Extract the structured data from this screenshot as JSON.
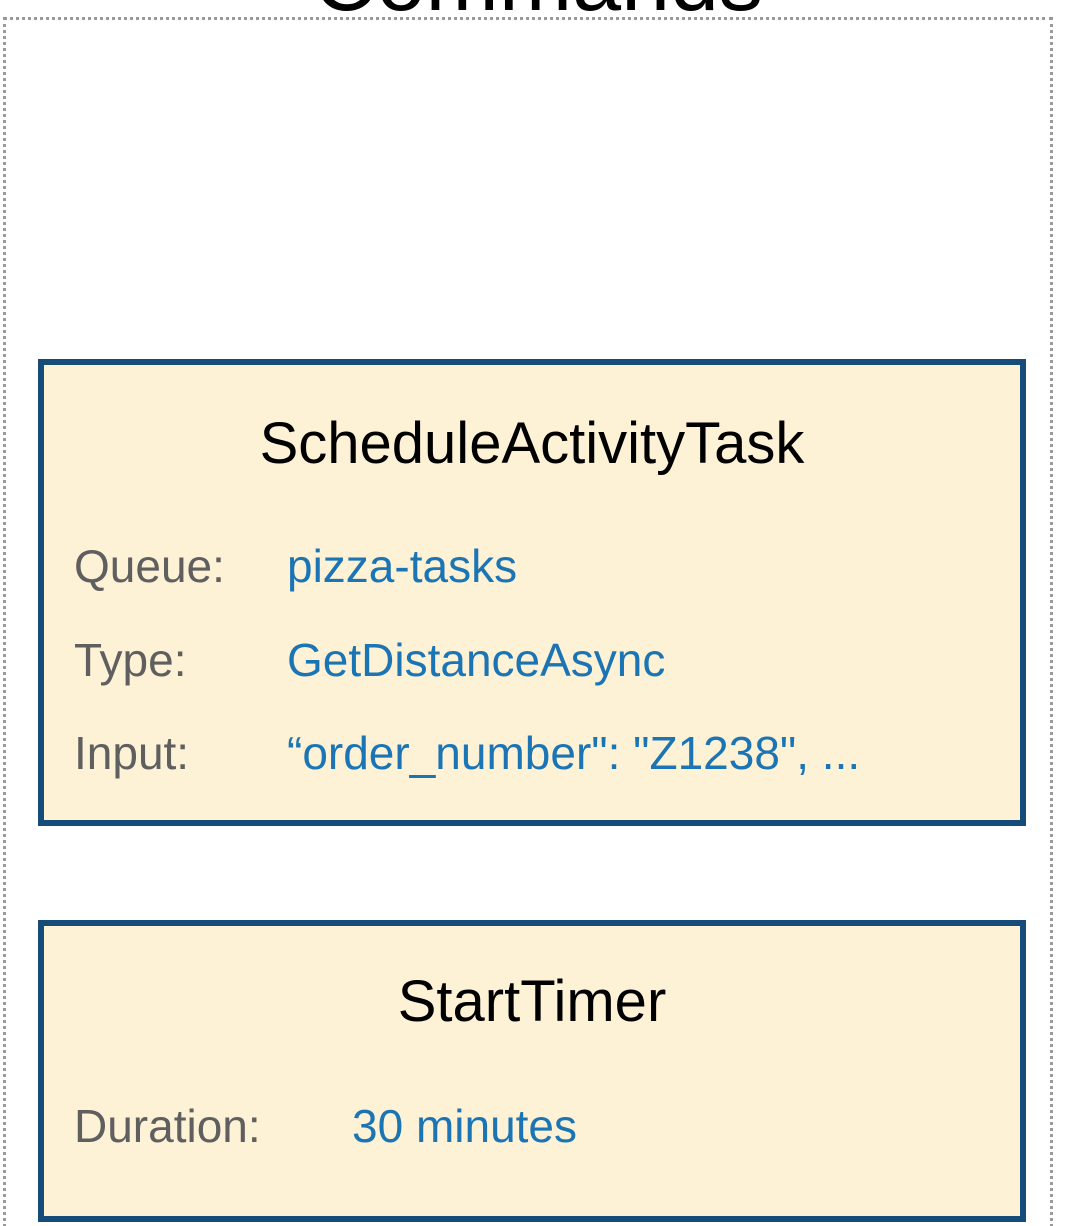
{
  "frame": {
    "title": "Commands"
  },
  "commands": [
    {
      "name": "ScheduleActivityTask",
      "fields": [
        {
          "label": "Queue:",
          "value": "pizza-tasks"
        },
        {
          "label": "Type:",
          "value": "GetDistanceAsync"
        },
        {
          "label": "Input:",
          "value": "“order_number\": \"Z1238\", ..."
        }
      ]
    },
    {
      "name": "StartTimer",
      "fields": [
        {
          "label": "Duration:",
          "value": "30 minutes"
        }
      ]
    }
  ],
  "colors": {
    "card_background": "#fdf1d6",
    "card_border": "#154c79",
    "label_text": "#5f5f5f",
    "value_text": "#1b75b5",
    "frame_border": "#999999"
  }
}
